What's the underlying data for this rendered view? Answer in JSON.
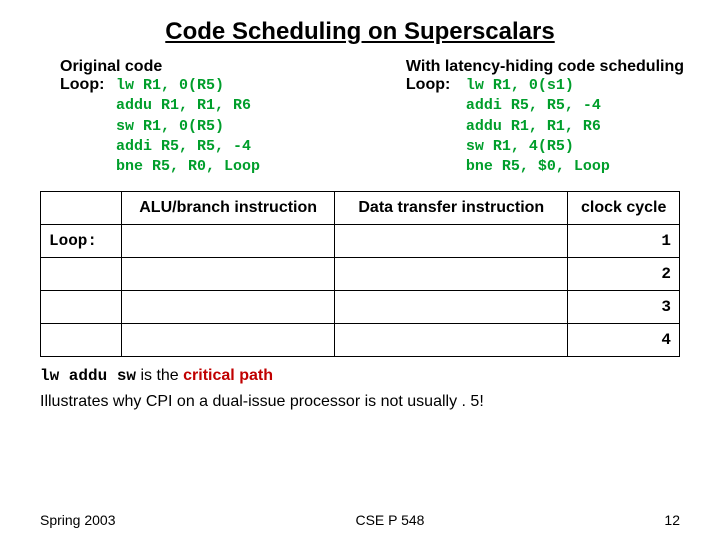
{
  "title": "Code Scheduling on Superscalars",
  "left": {
    "header": "Original code",
    "loop_label": "Loop:",
    "lines": [
      "lw R1, 0(R5)",
      "addu R1, R1, R6",
      "sw R1, 0(R5)",
      "addi R5, R5, -4",
      "bne R5, R0, Loop"
    ]
  },
  "right": {
    "header": "With latency-hiding code scheduling",
    "loop_label": "Loop:",
    "lines": [
      "lw R1, 0(s1)",
      "addi R5, R5, -4",
      "addu R1, R1, R6",
      "sw R1, 4(R5)",
      "bne R5, $0, Loop"
    ]
  },
  "table": {
    "headers": {
      "col1": "",
      "col2": "ALU/branch instruction",
      "col3": "Data transfer instruction",
      "col4": "clock cycle"
    },
    "rows": [
      {
        "col1": "Loop:",
        "col2": "",
        "col3": "",
        "cycle": "1"
      },
      {
        "col1": "",
        "col2": "",
        "col3": "",
        "cycle": "2"
      },
      {
        "col1": "",
        "col2": "",
        "col3": "",
        "cycle": "3"
      },
      {
        "col1": "",
        "col2": "",
        "col3": "",
        "cycle": "4"
      }
    ]
  },
  "bottom": {
    "mono_seq": "lw addu sw",
    "line1_mid": " is the ",
    "critical": "critical path",
    "line2": "Illustrates why CPI on a dual-issue processor is not usually . 5!"
  },
  "footer": {
    "left": "Spring 2003",
    "center": "CSE P 548",
    "right": "12"
  }
}
